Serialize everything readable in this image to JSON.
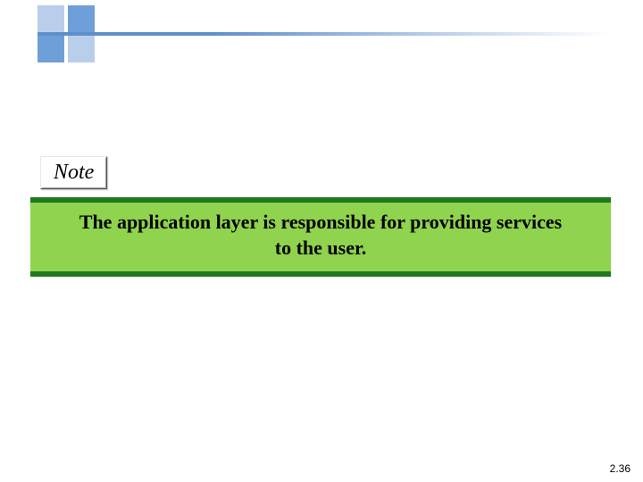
{
  "note_label": "Note",
  "banner_text": "The application layer is responsible for providing services to the user.",
  "page_number": "2.36",
  "colors": {
    "motif_primary": "#6f9fd8",
    "motif_light": "#b8ceea",
    "banner_bg": "#8fd34f",
    "banner_border": "#1f7a1f"
  },
  "icons": {
    "motif": "square-cross-icon"
  }
}
